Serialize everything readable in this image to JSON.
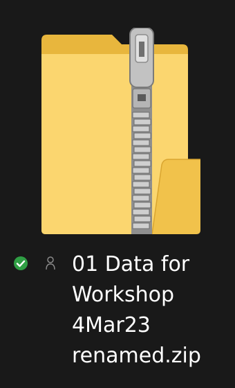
{
  "file": {
    "name_lines": [
      "01 Data for",
      "Workshop",
      "4Mar23",
      "renamed.zip"
    ],
    "type_icon": "zip-folder-icon",
    "sync_status_icon": "available-offline-icon",
    "sharing_icon": "person-icon"
  },
  "colors": {
    "background": "#191919",
    "folder_back": "#e8b63d",
    "folder_front": "#fbd66f",
    "zipper_metal": "#a6a6a6",
    "sync_green": "#2f9e44",
    "text": "#ffffff"
  }
}
